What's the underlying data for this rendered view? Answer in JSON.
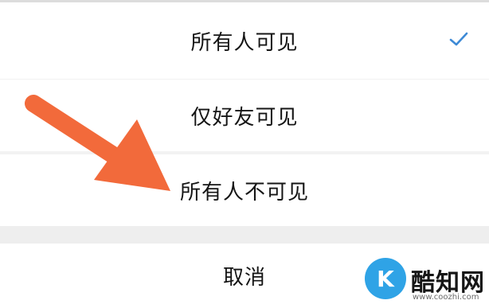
{
  "sheet": {
    "options": [
      {
        "label": "所有人可见",
        "selected": true
      },
      {
        "label": "仅好友可见",
        "selected": false
      },
      {
        "label": "所有人不可见",
        "selected": false
      }
    ],
    "cancel_label": "取消",
    "selected_icon": "checkmark-icon"
  },
  "annotation": {
    "arrow_color": "#f26a3b",
    "points_to": "所有人不可见"
  },
  "watermark": {
    "name": "酷知网",
    "url": "www.coozhi.com",
    "logo_color": "#2fa3e6"
  },
  "colors": {
    "text": "#151515",
    "check": "#3e8ad6",
    "background": "#f2f2f2"
  }
}
